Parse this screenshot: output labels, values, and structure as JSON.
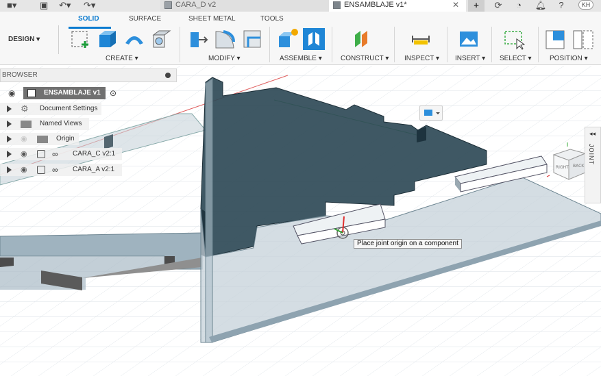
{
  "window": {
    "tabs": [
      {
        "label": "CARA_D v2",
        "active": false
      },
      {
        "label": "ENSAMBLAJE v1*",
        "active": true
      }
    ],
    "user_initials": "KH"
  },
  "ribbon": {
    "workspace": "DESIGN",
    "tabs": [
      "SOLID",
      "SURFACE",
      "SHEET METAL",
      "TOOLS"
    ],
    "active_tab": "SOLID",
    "groups": [
      "CREATE",
      "MODIFY",
      "ASSEMBLE",
      "CONSTRUCT",
      "INSPECT",
      "INSERT",
      "SELECT",
      "POSITION"
    ]
  },
  "browser": {
    "title": "BROWSER",
    "root": "ENSAMBLAJE v1",
    "items": [
      {
        "label": "Document Settings",
        "icon": "gear-icon"
      },
      {
        "label": "Named Views",
        "icon": "folder-icon"
      },
      {
        "label": "Origin",
        "icon": "folder-icon"
      },
      {
        "label": "CARA_C v2:1",
        "icon": "component-icon"
      },
      {
        "label": "CARA_A v2:1",
        "icon": "component-icon"
      }
    ]
  },
  "joint_panel": {
    "label": "JOINT"
  },
  "tooltip": {
    "text": "Place joint origin on a component"
  },
  "viewcube": {
    "faces": [
      "RIGHT",
      "BACK"
    ]
  },
  "colors": {
    "accent": "#0b7bd0",
    "selected_plate": "#2f4a57",
    "ghost_plate": "#9fb3bf",
    "grid": "#c9d1d8"
  }
}
